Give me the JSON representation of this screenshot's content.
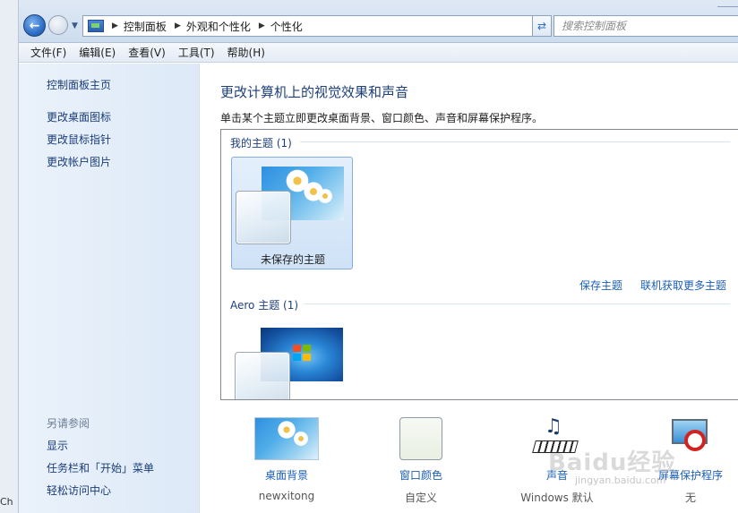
{
  "taskbar_peek": "Ch",
  "address": {
    "crumbs": [
      "控制面板",
      "外观和个性化",
      "个性化"
    ],
    "search_placeholder": "搜索控制面板"
  },
  "menu": [
    "文件(F)",
    "编辑(E)",
    "查看(V)",
    "工具(T)",
    "帮助(H)"
  ],
  "left_pane": {
    "home": "控制面板主页",
    "links": [
      "更改桌面图标",
      "更改鼠标指针",
      "更改帐户图片"
    ],
    "see_also_header": "另请参阅",
    "see_also": [
      "显示",
      "任务栏和「开始」菜单",
      "轻松访问中心"
    ]
  },
  "main": {
    "title": "更改计算机上的视觉效果和声音",
    "description": "单击某个主题立即更改桌面背景、窗口颜色、声音和屏幕保护程序。",
    "my_themes_header": "我的主题 (1)",
    "unsaved_theme": "未保存的主题",
    "save_theme": "保存主题",
    "get_more_themes": "联机获取更多主题",
    "aero_header": "Aero 主题 (1)"
  },
  "settings": [
    {
      "label": "桌面背景",
      "value": "newxitong"
    },
    {
      "label": "窗口颜色",
      "value": "自定义"
    },
    {
      "label": "声音",
      "value": "Windows 默认"
    },
    {
      "label": "屏幕保护程序",
      "value": "无"
    }
  ],
  "watermark": {
    "text": "Baidu经验",
    "url": "jingyan.baidu.com"
  },
  "colors": {
    "link": "#1b5fb5",
    "title": "#1e3f7a",
    "left_pane": "#e4eef9"
  }
}
